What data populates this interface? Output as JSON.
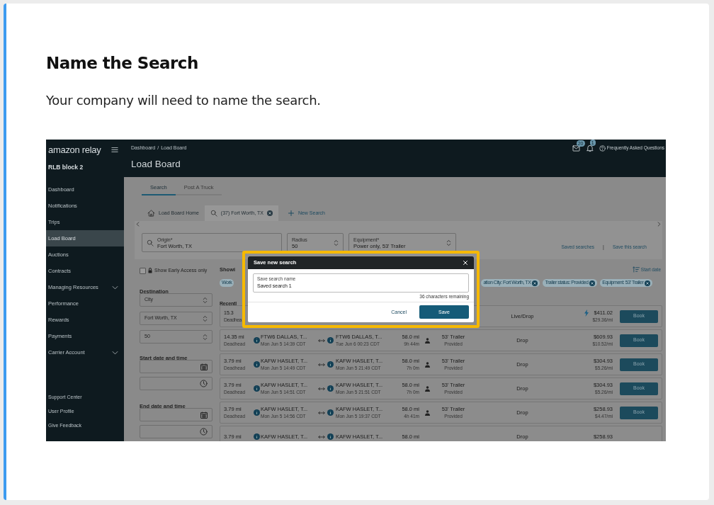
{
  "heading": "Name the Search",
  "description": "Your company will need to name the search.",
  "app": {
    "logo": "amazon relay",
    "account": "RLB block 2",
    "nav": [
      {
        "label": "Dashboard",
        "selected": false,
        "expandable": false
      },
      {
        "label": "Notifications",
        "selected": false,
        "expandable": false
      },
      {
        "label": "Trips",
        "selected": false,
        "expandable": false
      },
      {
        "label": "Load Board",
        "selected": true,
        "expandable": false
      },
      {
        "label": "Auctions",
        "selected": false,
        "expandable": false
      },
      {
        "label": "Contracts",
        "selected": false,
        "expandable": false
      },
      {
        "label": "Managing Resources",
        "selected": false,
        "expandable": true
      },
      {
        "label": "Performance",
        "selected": false,
        "expandable": false
      },
      {
        "label": "Rewards",
        "selected": false,
        "expandable": false
      },
      {
        "label": "Payments",
        "selected": false,
        "expandable": false
      },
      {
        "label": "Carrier Account",
        "selected": false,
        "expandable": true
      }
    ],
    "nav_bottom": [
      "Support Center",
      "User Profile",
      "Give Feedback"
    ],
    "breadcrumb": {
      "items": [
        "Dashboard",
        "Load Board"
      ],
      "separator": "/"
    },
    "page_title": "Load Board",
    "messages_count": "20",
    "notifications_count": "1",
    "help_link": "Frequently Asked Questions",
    "tabs": [
      {
        "label": "Search",
        "selected": true
      },
      {
        "label": "Post A Truck",
        "selected": false
      }
    ],
    "search_tabs": [
      {
        "kind": "home",
        "label": "Load Board Home",
        "selected": false
      },
      {
        "kind": "search",
        "label": "(37) Fort Worth, TX",
        "selected": true
      }
    ],
    "new_search": "New Search",
    "filters": [
      {
        "kind": "search",
        "label": "Origin*",
        "value": "Fort Worth, TX"
      },
      {
        "kind": "select",
        "label": "Radius",
        "value": "50"
      },
      {
        "kind": "select",
        "label": "Equipment*",
        "value": "Power only, 53' Trailer"
      }
    ],
    "saved_searches": "Saved searches",
    "link_separator": "|",
    "save_this_search": "Save this search",
    "early_access": {
      "label": "Show Early Access only",
      "checked": false
    },
    "destination": {
      "title": "Destination",
      "fields": [
        "City",
        "Fort Worth, TX",
        "50"
      ]
    },
    "start_title": "Start date and time",
    "end_title": "End date and time",
    "results_heading": "Showi",
    "sort": "Start date",
    "chips": [
      {
        "label": "Work",
        "removable": false
      },
      {
        "label": "ation City: Fort Worth, TX",
        "removable": true
      },
      {
        "label": "Trailer status: Provided",
        "removable": true
      },
      {
        "label": "Equipment: 53' Trailer",
        "removable": true
      }
    ],
    "section": "Recentl",
    "rows": [
      {
        "deadhead": "15.3",
        "deadhead_label": "Deadhea",
        "work_type": "Live/Drop",
        "boosted": true,
        "price": "$411.02",
        "rate": "$29.36/mi",
        "action": "Book"
      },
      {
        "deadhead": "14.35 mi",
        "deadhead_label": "Deadhead",
        "origin": "FTW6 DALLAS, T...",
        "origin_time": "Mon Jun 5 14:39 CDT",
        "destination": "FTW6 DALLAS, T...",
        "destination_time": "Tue Jun 6 00:23 CDT",
        "distance": "58.0 mi",
        "duration": "9h 44m",
        "equipment": "53' Trailer",
        "equipment_status": "Provided",
        "work_type": "Drop",
        "boosted": false,
        "price": "$609.93",
        "rate": "$10.52/mi",
        "action": "Book"
      },
      {
        "deadhead": "3.79 mi",
        "deadhead_label": "Deadhead",
        "origin": "KAFW HASLET, T...",
        "origin_time": "Mon Jun 5 14:49 CDT",
        "destination": "KAFW HASLET, T...",
        "destination_time": "Mon Jun 5 21:49 CDT",
        "distance": "58.0 mi",
        "duration": "7h 0m",
        "equipment": "53' Trailer",
        "equipment_status": "Provided",
        "work_type": "Drop",
        "boosted": false,
        "price": "$304.93",
        "rate": "$5.26/mi",
        "action": "Book"
      },
      {
        "deadhead": "3.79 mi",
        "deadhead_label": "Deadhead",
        "origin": "KAFW HASLET, T...",
        "origin_time": "Mon Jun 5 14:51 CDT",
        "destination": "KAFW HASLET, T...",
        "destination_time": "Mon Jun 5 21:51 CDT",
        "distance": "58.0 mi",
        "duration": "7h 0m",
        "equipment": "53' Trailer",
        "equipment_status": "Provided",
        "work_type": "Drop",
        "boosted": false,
        "price": "$304.93",
        "rate": "$5.26/mi",
        "action": "Book"
      },
      {
        "deadhead": "3.79 mi",
        "deadhead_label": "Deadhead",
        "origin": "KAFW HASLET, T...",
        "origin_time": "Mon Jun 5 14:56 CDT",
        "destination": "KAFW HASLET, T...",
        "destination_time": "Mon Jun 5 19:37 CDT",
        "distance": "58.0 mi",
        "duration": "4h 41m",
        "equipment": "53' Trailer",
        "equipment_status": "Provided",
        "work_type": "Drop",
        "boosted": false,
        "price": "$258.93",
        "rate": "$4.47/mi",
        "action": "Book"
      },
      {
        "deadhead": "3.79 mi",
        "origin": "KAFW HASLET, T...",
        "destination": "KAFW HASLET, T...",
        "distance": "58.0 mi",
        "work_type": "Drop",
        "boosted": false,
        "price": "$258.93"
      }
    ],
    "modal": {
      "title": "Save new search",
      "field_label": "Save search name",
      "value": "Saved search 1",
      "hint": "36 characters remaining",
      "cancel": "Cancel",
      "save": "Save"
    }
  }
}
